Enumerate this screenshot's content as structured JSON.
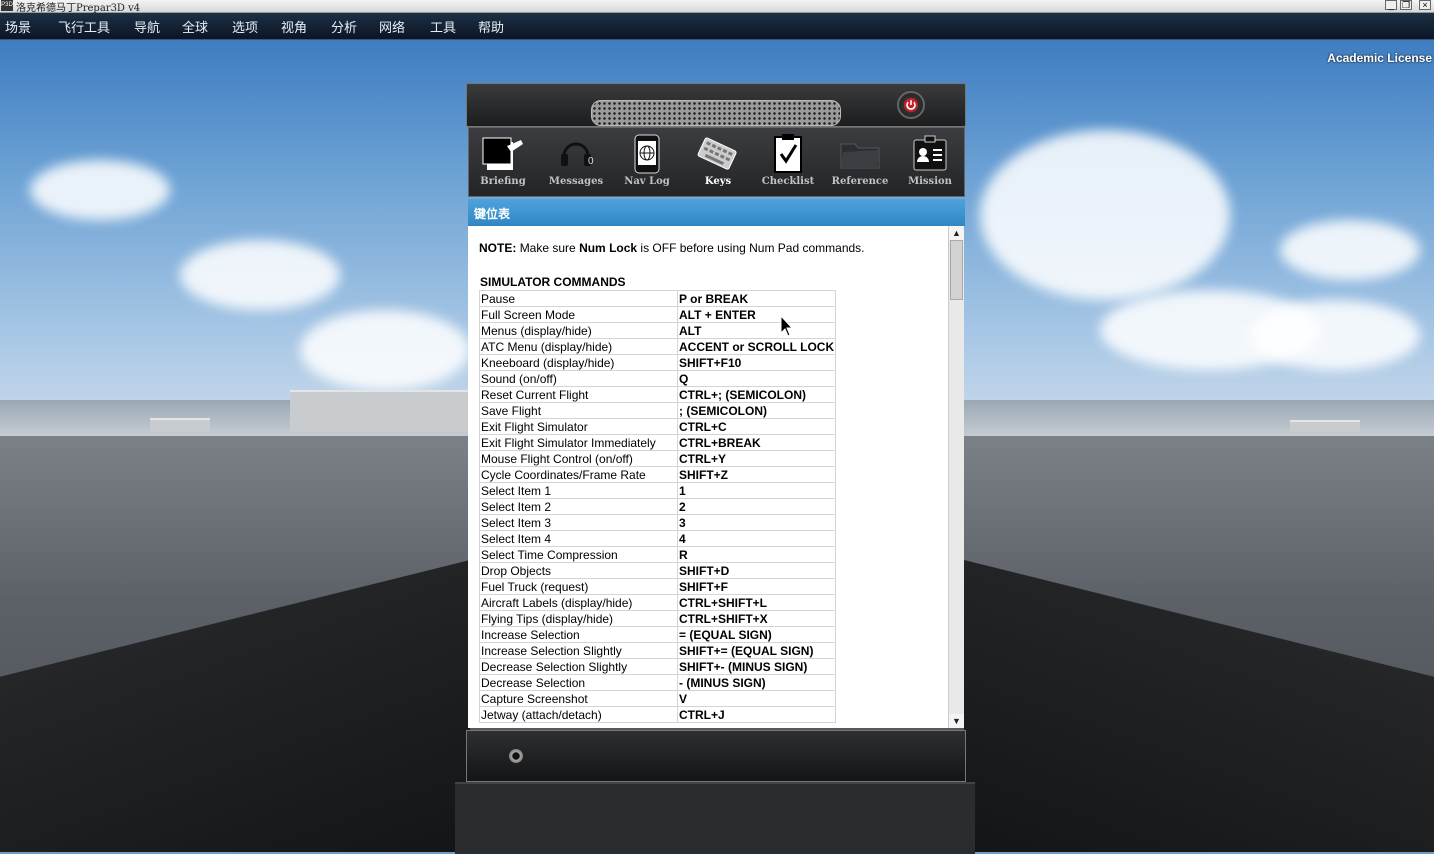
{
  "titlebar": {
    "title": "洛克希德马丁Prepar3D v4",
    "icon": "app-icon",
    "buttons": [
      "minimize",
      "restore",
      "close"
    ]
  },
  "menu": [
    "场景",
    "飞行工具",
    "导航",
    "全球",
    "选项",
    "视角",
    "分析",
    "网络",
    "工具",
    "帮助"
  ],
  "license": "Academic License",
  "kneeboard": {
    "toolbar": [
      {
        "label": "Briefing",
        "icon": "briefing-icon"
      },
      {
        "label": "Messages",
        "icon": "headset-icon"
      },
      {
        "label": "Nav Log",
        "icon": "globe-device-icon"
      },
      {
        "label": "Keys",
        "icon": "keyboard-icon"
      },
      {
        "label": "Checklist",
        "icon": "clipboard-check-icon"
      },
      {
        "label": "Reference",
        "icon": "folder-icon"
      },
      {
        "label": "Mission",
        "icon": "id-card-icon"
      }
    ],
    "header": "键位表",
    "note_label": "NOTE:",
    "note_pre": "Make sure",
    "note_key": "Num Lock",
    "note_post": "is OFF before using Num Pad commands.",
    "section": "SIMULATOR COMMANDS",
    "rows": [
      [
        "Pause",
        "P or BREAK"
      ],
      [
        "Full Screen Mode",
        "ALT + ENTER"
      ],
      [
        "Menus (display/hide)",
        "ALT"
      ],
      [
        "ATC Menu (display/hide)",
        "ACCENT or SCROLL LOCK"
      ],
      [
        "Kneeboard (display/hide)",
        "SHIFT+F10"
      ],
      [
        "Sound (on/off)",
        "Q"
      ],
      [
        "Reset Current Flight",
        "CTRL+; (SEMICOLON)"
      ],
      [
        "Save Flight",
        "; (SEMICOLON)"
      ],
      [
        "Exit Flight Simulator",
        "CTRL+C"
      ],
      [
        "Exit Flight Simulator Immediately",
        "CTRL+BREAK"
      ],
      [
        "Mouse Flight Control (on/off)",
        "CTRL+Y"
      ],
      [
        "Cycle Coordinates/Frame Rate",
        "SHIFT+Z"
      ],
      [
        "Select Item 1",
        "1"
      ],
      [
        "Select Item 2",
        "2"
      ],
      [
        "Select Item 3",
        "3"
      ],
      [
        "Select Item 4",
        "4"
      ],
      [
        "Select Time Compression",
        "R"
      ],
      [
        "Drop Objects",
        "SHIFT+D"
      ],
      [
        "Fuel Truck (request)",
        "SHIFT+F"
      ],
      [
        "Aircraft Labels (display/hide)",
        "CTRL+SHIFT+L"
      ],
      [
        "Flying Tips (display/hide)",
        "CTRL+SHIFT+X"
      ],
      [
        "Increase Selection",
        "= (EQUAL SIGN)"
      ],
      [
        "Increase Selection Slightly",
        "SHIFT+= (EQUAL SIGN)"
      ],
      [
        "Decrease Selection Slightly",
        "SHIFT+- (MINUS SIGN)"
      ],
      [
        "Decrease Selection",
        "- (MINUS SIGN)"
      ],
      [
        "Capture Screenshot",
        "V"
      ],
      [
        "Jetway (attach/detach)",
        "CTRL+J"
      ]
    ]
  }
}
